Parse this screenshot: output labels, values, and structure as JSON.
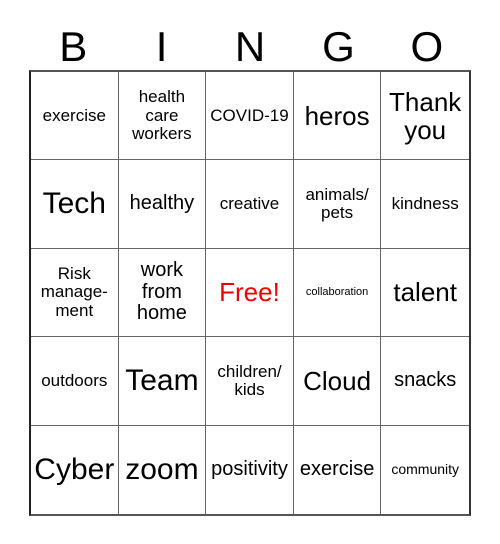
{
  "card": {
    "title_letters": [
      "B",
      "I",
      "N",
      "G",
      "O"
    ],
    "free_color": "#ee0000",
    "text_color": "#000000",
    "border_color": "#666666",
    "background": "#ffffff"
  },
  "grid": {
    "columns": 5,
    "rows": 5,
    "cells": [
      {
        "text": "exercise",
        "size": "md"
      },
      {
        "text": "health care workers",
        "size": "md"
      },
      {
        "text": "COVID-19",
        "size": "md"
      },
      {
        "text": "heros",
        "size": "xl"
      },
      {
        "text": "Thank you",
        "size": "xl"
      },
      {
        "text": "Tech",
        "size": "xxl"
      },
      {
        "text": "healthy",
        "size": "lg"
      },
      {
        "text": "creative",
        "size": "md"
      },
      {
        "text": "animals/ pets",
        "size": "md"
      },
      {
        "text": "kindness",
        "size": "md"
      },
      {
        "text": "Risk manage- ment",
        "size": "md"
      },
      {
        "text": "work from home",
        "size": "lg"
      },
      {
        "text": "Free!",
        "size": "xl"
      },
      {
        "text": "collaboration",
        "size": "xs"
      },
      {
        "text": "talent",
        "size": "xl"
      },
      {
        "text": "outdoors",
        "size": "md"
      },
      {
        "text": "Team",
        "size": "xxl"
      },
      {
        "text": "children/ kids",
        "size": "md"
      },
      {
        "text": "Cloud",
        "size": "xl"
      },
      {
        "text": "snacks",
        "size": "lg"
      },
      {
        "text": "Cyber",
        "size": "xxl"
      },
      {
        "text": "zoom",
        "size": "xxl"
      },
      {
        "text": "positivity",
        "size": "lg"
      },
      {
        "text": "exercise",
        "size": "lg"
      },
      {
        "text": "community",
        "size": "sm"
      }
    ]
  }
}
